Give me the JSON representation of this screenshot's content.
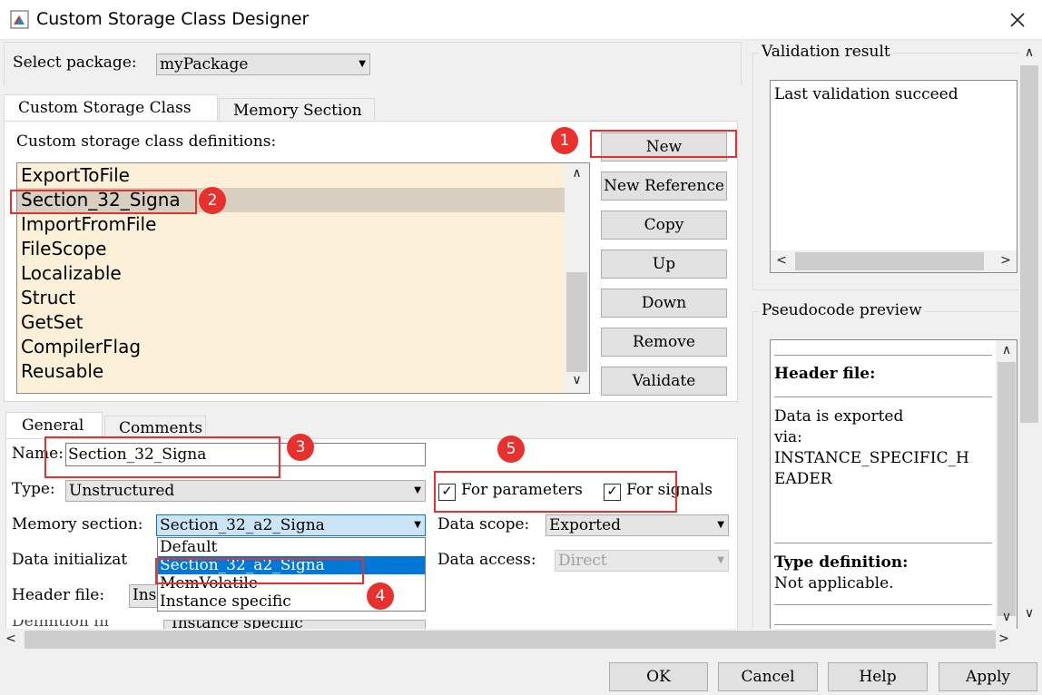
{
  "window": {
    "title": "Custom Storage Class Designer",
    "close_icon": "close-icon"
  },
  "package": {
    "label": "Select package:",
    "value": "myPackage"
  },
  "tabs": [
    {
      "label": "Custom Storage Class"
    },
    {
      "label": "Memory Section"
    }
  ],
  "definitions": {
    "label": "Custom storage class definitions:",
    "items": [
      "ExportToFile",
      "Section_32_Signa",
      "ImportFromFile",
      "FileScope",
      "Localizable",
      "Struct",
      "GetSet",
      "CompilerFlag",
      "Reusable"
    ],
    "selected_index": 1
  },
  "buttons": {
    "new": "New",
    "new_reference": "New Reference",
    "copy": "Copy",
    "up": "Up",
    "down": "Down",
    "remove": "Remove",
    "validate": "Validate"
  },
  "sub_tabs": [
    {
      "label": "General"
    },
    {
      "label": "Comments"
    }
  ],
  "general": {
    "name_label": "Name:",
    "name_value": "Section_32_Signa",
    "type_label": "Type:",
    "type_value": "Unstructured",
    "for_parameters": "For parameters",
    "for_signals": "For signals",
    "memory_section_label": "Memory section:",
    "memory_section_value": "Section_32_a2_Signa",
    "memory_options": [
      "Default",
      "Section_32_a2_Signa",
      "MemVolatile",
      "Instance specific"
    ],
    "memory_selected_index": 1,
    "data_scope_label": "Data scope:",
    "data_scope_value": "Exported",
    "data_init_label": "Data initializat",
    "data_access_label": "Data access:",
    "data_access_value": "Direct",
    "header_file_label": "Header file:",
    "header_file_value": "Ins",
    "definition_file_label": "Definition fil",
    "definition_file_value": "Instance specific"
  },
  "validation": {
    "title": "Validation result",
    "text": "Last validation succeed"
  },
  "pseudocode": {
    "title": "Pseudocode preview",
    "header_file_label": "Header file:",
    "header_file_text": [
      "Data is exported",
      "via:",
      "INSTANCE_SPECIFIC_H",
      "EADER"
    ],
    "type_def_label": "Type definition:",
    "type_def_text": "Not applicable."
  },
  "footer": {
    "ok": "OK",
    "cancel": "Cancel",
    "help": "Help",
    "apply": "Apply"
  },
  "badges": [
    "1",
    "2",
    "3",
    "4",
    "5"
  ],
  "colors": {
    "annotation": "#e8312f",
    "list_bg": "#fdf0d8",
    "selection": "#0078d7"
  }
}
